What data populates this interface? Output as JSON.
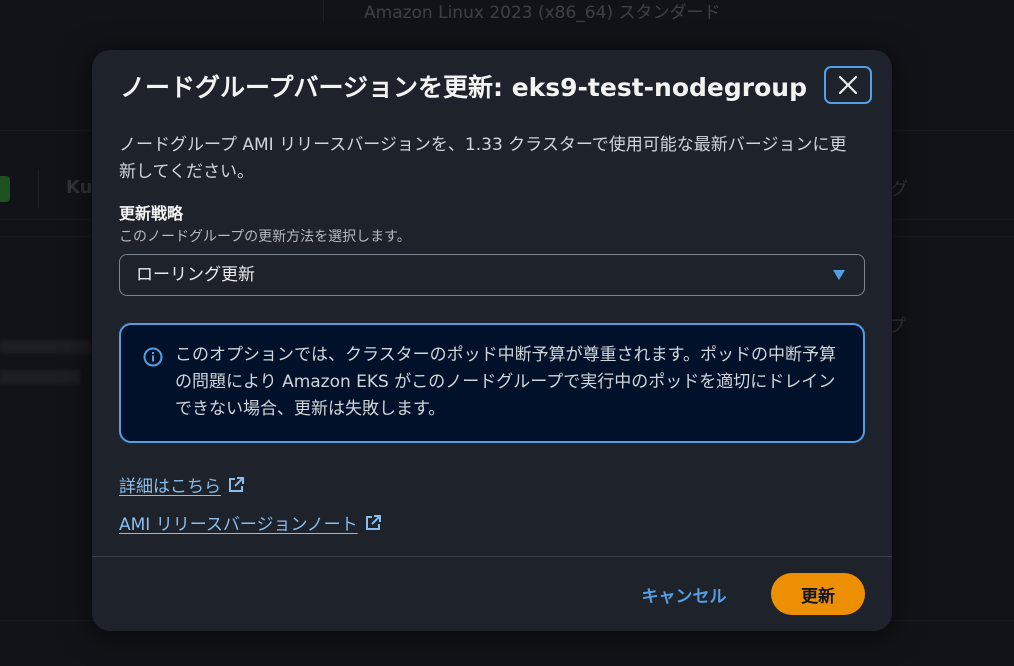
{
  "background": {
    "ami_type": "Amazon Linux 2023 (x86_64) スタンダード",
    "tab_partial": "Ku",
    "right_partial_1": "グ",
    "right_partial_2": "プ"
  },
  "modal": {
    "title": "ノードグループバージョンを更新: eks9-test-nodegroup",
    "description": "ノードグループ AMI リリースバージョンを、1.33 クラスターで使用可能な最新バージョンに更新してください。",
    "strategy": {
      "label": "更新戦略",
      "description": "このノードグループの更新方法を選択します。",
      "selected": "ローリング更新"
    },
    "alert": {
      "text": "このオプションでは、クラスターのポッド中断予算が尊重されます。ポッドの中断予算の問題により Amazon EKS がこのノードグループで実行中のポッドを適切にドレインできない場合、更新は失敗します。"
    },
    "links": {
      "learn_more": "詳細はこちら",
      "release_notes": "AMI リリースバージョンノート"
    },
    "footer": {
      "cancel_label": "キャンセル",
      "update_label": "更新"
    }
  },
  "colors": {
    "accent_blue": "#539fe5",
    "link_blue": "#89bdee",
    "primary_orange": "#ff9900",
    "modal_bg": "#1e222a",
    "alert_bg": "#001129"
  },
  "icons": {
    "close": "close-icon",
    "caret": "caret-down-icon",
    "info": "info-icon",
    "external": "external-link-icon"
  }
}
